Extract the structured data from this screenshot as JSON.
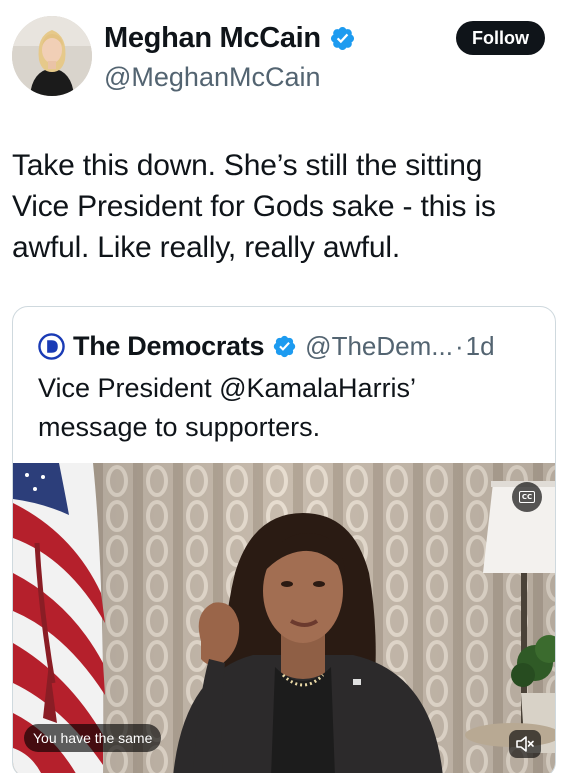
{
  "tweet": {
    "author": {
      "display_name": "Meghan McCain",
      "handle": "@MeghanMcCain",
      "verified": true
    },
    "follow_label": "Follow",
    "text": "Take this down. She’s still the sitting\nVice President for Gods sake - this is\nawful. Like really, really awful."
  },
  "quoted_tweet": {
    "author": {
      "display_name": "The Democrats",
      "handle": "@TheDem...",
      "verified": true,
      "logo_letter": "D"
    },
    "separator": "·",
    "time": "1d",
    "text": "Vice President @KamalaHarris’\nmessage to supporters.",
    "video": {
      "caption": "You have the same",
      "cc_label": "CC"
    }
  },
  "colors": {
    "text_primary": "#0f1419",
    "text_secondary": "#536471",
    "verified_blue": "#1d9bf0",
    "democrats_blue": "#1a3bb5",
    "follow_bg": "#0f1419",
    "border": "#cfd9de"
  },
  "icons": {
    "verified": "verified-badge-icon",
    "logo": "democrats-logo-icon",
    "cc": "closed-captions-icon",
    "mute": "speaker-muted-icon"
  }
}
